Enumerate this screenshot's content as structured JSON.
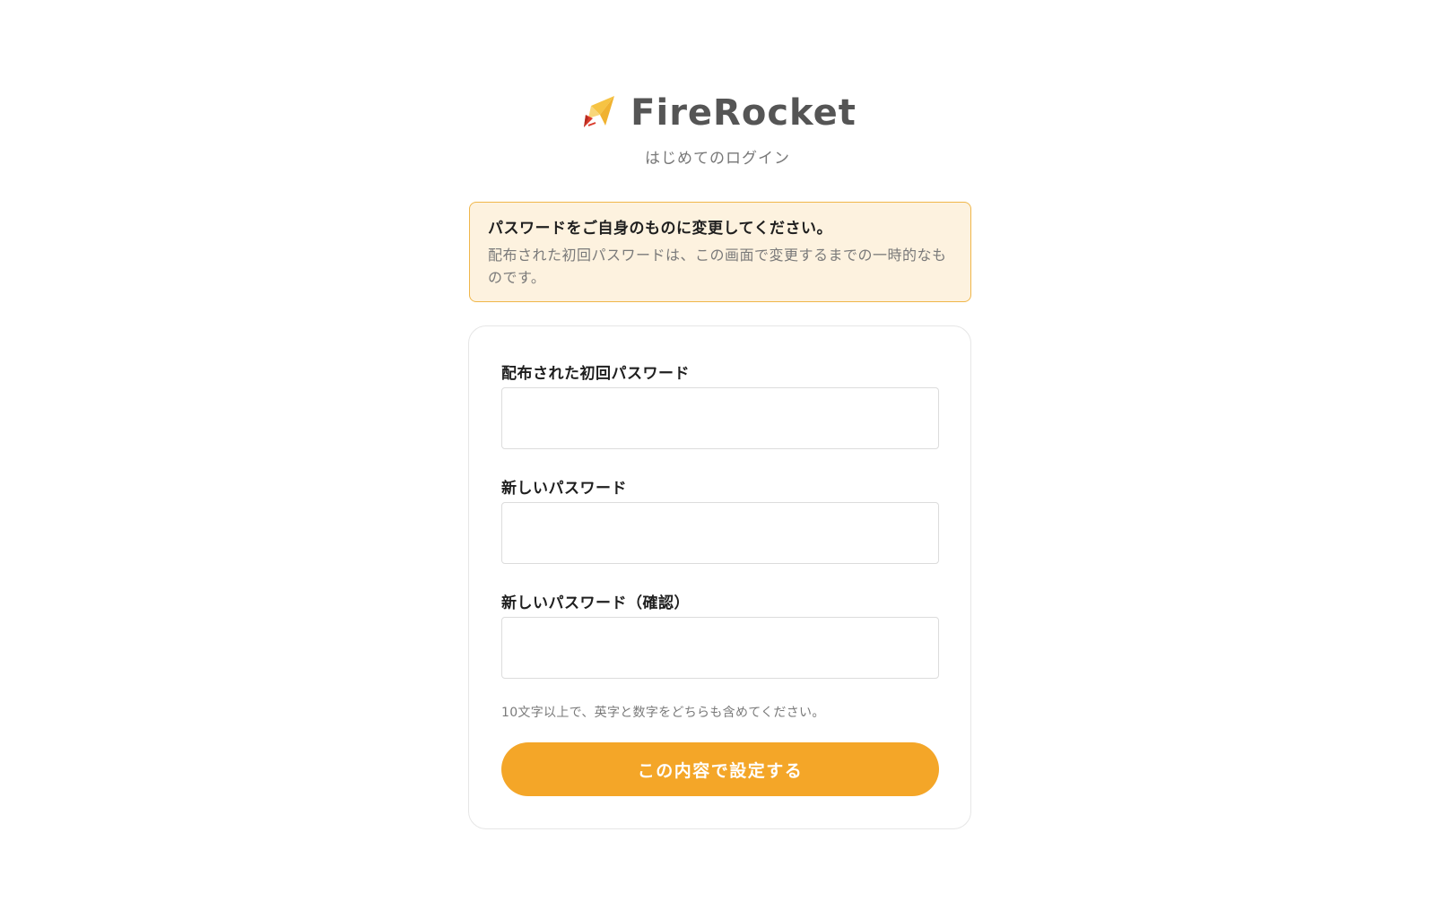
{
  "header": {
    "logo_icon": "paper-rocket-icon",
    "brand_name": "FireRocket",
    "subtitle": "はじめてのログイン"
  },
  "notice": {
    "title": "パスワードをご自身のものに変更してください。",
    "body": "配布された初回パスワードは、この画面で変更するまでの一時的なものです。"
  },
  "form": {
    "fields": [
      {
        "label": "配布された初回パスワード",
        "value": "",
        "placeholder": ""
      },
      {
        "label": "新しいパスワード",
        "value": "",
        "placeholder": ""
      },
      {
        "label": "新しいパスワード（確認）",
        "value": "",
        "placeholder": ""
      }
    ],
    "hint": "10文字以上で、英字と数字をどちらも含めてください。",
    "submit_label": "この内容で設定する"
  },
  "colors": {
    "accent": "#f4a628",
    "notice_bg": "#fdf2df",
    "notice_border": "#f0b64a",
    "brand_text": "#555555",
    "logo_red": "#d93a2b",
    "logo_yellow": "#f6c343"
  }
}
